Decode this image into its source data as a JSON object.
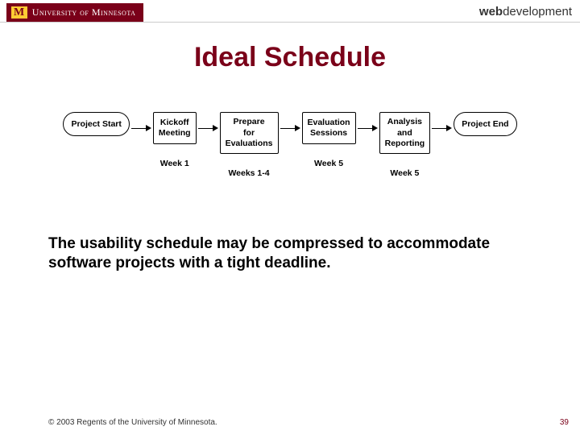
{
  "header": {
    "logo_letter": "M",
    "logo_text": "University of Minnesota",
    "brand_bold": "web",
    "brand_rest": "development"
  },
  "title": "Ideal Schedule",
  "flow": {
    "start": "Project Start",
    "n1": "Kickoff\nMeeting",
    "n2": "Prepare\nfor\nEvaluations",
    "n3": "Evaluation\nSessions",
    "n4": "Analysis\nand\nReporting",
    "end": "Project End",
    "w1": "Week 1",
    "w2": "Weeks 1-4",
    "w3": "Week 5",
    "w4": "Week 5"
  },
  "body": "The usability schedule may be compressed to accommodate software projects with a tight deadline.",
  "footer": {
    "copyright": "© 2003 Regents of the University of Minnesota.",
    "page": "39"
  }
}
